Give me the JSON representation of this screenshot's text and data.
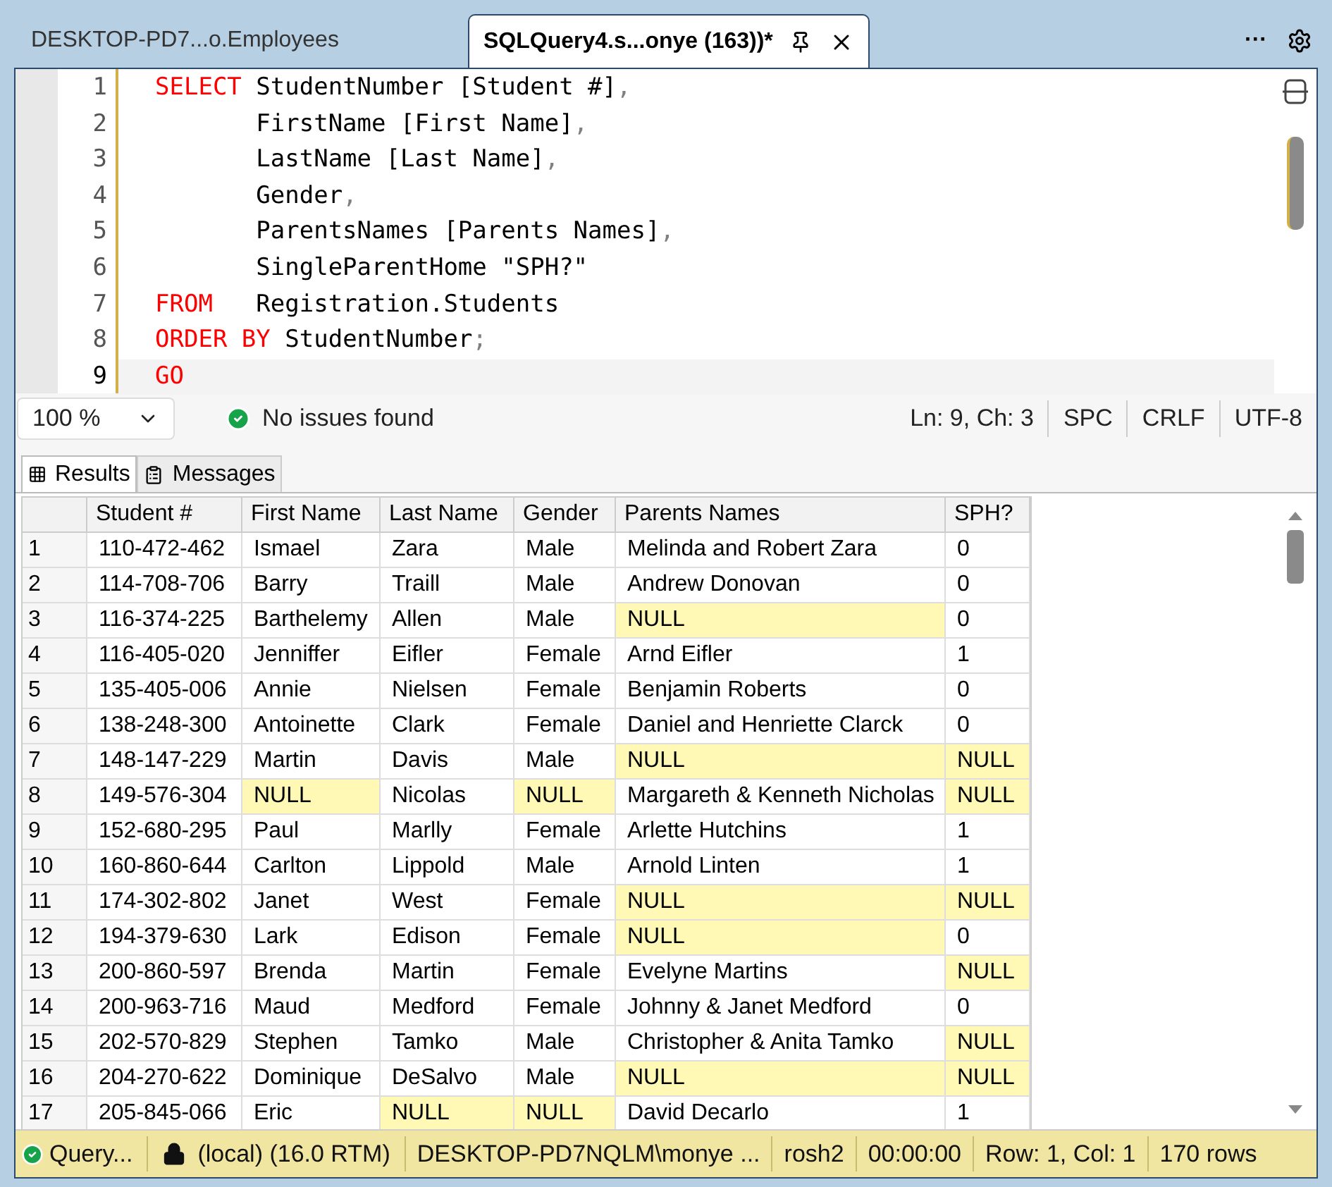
{
  "tabs": [
    {
      "label": "DESKTOP-PD7...o.Employees",
      "selected": false
    },
    {
      "label": "SQLQuery4.s...onye (163))*",
      "selected": true
    }
  ],
  "tab_bar_actions": {
    "more": "···"
  },
  "editor": {
    "lines": [
      {
        "number": "1",
        "current": false,
        "tokens": [
          {
            "kind": "keyword",
            "text": "SELECT"
          },
          {
            "kind": "text",
            "text": " StudentNumber [Student #]"
          },
          {
            "kind": "punct",
            "text": ","
          }
        ]
      },
      {
        "number": "2",
        "current": false,
        "tokens": [
          {
            "kind": "text",
            "text": "       FirstName [First Name]"
          },
          {
            "kind": "punct",
            "text": ","
          }
        ]
      },
      {
        "number": "3",
        "current": false,
        "tokens": [
          {
            "kind": "text",
            "text": "       LastName [Last Name]"
          },
          {
            "kind": "punct",
            "text": ","
          }
        ]
      },
      {
        "number": "4",
        "current": false,
        "tokens": [
          {
            "kind": "text",
            "text": "       Gender"
          },
          {
            "kind": "punct",
            "text": ","
          }
        ]
      },
      {
        "number": "5",
        "current": false,
        "tokens": [
          {
            "kind": "text",
            "text": "       ParentsNames [Parents Names]"
          },
          {
            "kind": "punct",
            "text": ","
          }
        ]
      },
      {
        "number": "6",
        "current": false,
        "tokens": [
          {
            "kind": "text",
            "text": "       SingleParentHome \"SPH?\""
          }
        ]
      },
      {
        "number": "7",
        "current": false,
        "tokens": [
          {
            "kind": "keyword",
            "text": "FROM"
          },
          {
            "kind": "text",
            "text": "   Registration.Students"
          }
        ]
      },
      {
        "number": "8",
        "current": false,
        "tokens": [
          {
            "kind": "keyword",
            "text": "ORDER BY"
          },
          {
            "kind": "text",
            "text": " StudentNumber"
          },
          {
            "kind": "punct",
            "text": ";"
          }
        ]
      },
      {
        "number": "9",
        "current": true,
        "tokens": [
          {
            "kind": "keyword",
            "text": "GO"
          }
        ]
      }
    ]
  },
  "editor_status": {
    "zoom": "100 %",
    "issues": "No issues found",
    "items": [
      "Ln: 9, Ch: 3",
      "SPC",
      "CRLF",
      "UTF-8"
    ]
  },
  "result_tabs": [
    {
      "label": "Results",
      "selected": true
    },
    {
      "label": "Messages",
      "selected": false
    }
  ],
  "grid": {
    "columns": [
      "Student #",
      "First Name",
      "Last Name",
      "Gender",
      "Parents Names",
      "SPH?"
    ],
    "rows": [
      {
        "number": "1",
        "cells": [
          {
            "text": "110-472-462",
            "null": false
          },
          {
            "text": "Ismael",
            "null": false
          },
          {
            "text": "Zara",
            "null": false
          },
          {
            "text": "Male",
            "null": false
          },
          {
            "text": "Melinda and Robert Zara",
            "null": false
          },
          {
            "text": "0",
            "null": false
          }
        ]
      },
      {
        "number": "2",
        "cells": [
          {
            "text": "114-708-706",
            "null": false
          },
          {
            "text": "Barry",
            "null": false
          },
          {
            "text": "Traill",
            "null": false
          },
          {
            "text": "Male",
            "null": false
          },
          {
            "text": "Andrew Donovan",
            "null": false
          },
          {
            "text": "0",
            "null": false
          }
        ]
      },
      {
        "number": "3",
        "cells": [
          {
            "text": "116-374-225",
            "null": false
          },
          {
            "text": "Barthelemy",
            "null": false
          },
          {
            "text": "Allen",
            "null": false
          },
          {
            "text": "Male",
            "null": false
          },
          {
            "text": "NULL",
            "null": true
          },
          {
            "text": "0",
            "null": false
          }
        ]
      },
      {
        "number": "4",
        "cells": [
          {
            "text": "116-405-020",
            "null": false
          },
          {
            "text": "Jenniffer",
            "null": false
          },
          {
            "text": "Eifler",
            "null": false
          },
          {
            "text": "Female",
            "null": false
          },
          {
            "text": "Arnd Eifler",
            "null": false
          },
          {
            "text": "1",
            "null": false
          }
        ]
      },
      {
        "number": "5",
        "cells": [
          {
            "text": "135-405-006",
            "null": false
          },
          {
            "text": "Annie",
            "null": false
          },
          {
            "text": "Nielsen",
            "null": false
          },
          {
            "text": "Female",
            "null": false
          },
          {
            "text": "Benjamin Roberts",
            "null": false
          },
          {
            "text": "0",
            "null": false
          }
        ]
      },
      {
        "number": "6",
        "cells": [
          {
            "text": "138-248-300",
            "null": false
          },
          {
            "text": "Antoinette",
            "null": false
          },
          {
            "text": "Clark",
            "null": false
          },
          {
            "text": "Female",
            "null": false
          },
          {
            "text": "Daniel and Henriette Clarck",
            "null": false
          },
          {
            "text": "0",
            "null": false
          }
        ]
      },
      {
        "number": "7",
        "cells": [
          {
            "text": "148-147-229",
            "null": false
          },
          {
            "text": "Martin",
            "null": false
          },
          {
            "text": "Davis",
            "null": false
          },
          {
            "text": "Male",
            "null": false
          },
          {
            "text": "NULL",
            "null": true
          },
          {
            "text": "NULL",
            "null": true
          }
        ]
      },
      {
        "number": "8",
        "cells": [
          {
            "text": "149-576-304",
            "null": false
          },
          {
            "text": "NULL",
            "null": true
          },
          {
            "text": "Nicolas",
            "null": false
          },
          {
            "text": "NULL",
            "null": true
          },
          {
            "text": "Margareth & Kenneth Nicholas",
            "null": false
          },
          {
            "text": "NULL",
            "null": true
          }
        ]
      },
      {
        "number": "9",
        "cells": [
          {
            "text": "152-680-295",
            "null": false
          },
          {
            "text": "Paul",
            "null": false
          },
          {
            "text": "Marlly",
            "null": false
          },
          {
            "text": "Female",
            "null": false
          },
          {
            "text": "Arlette Hutchins",
            "null": false
          },
          {
            "text": "1",
            "null": false
          }
        ]
      },
      {
        "number": "10",
        "cells": [
          {
            "text": "160-860-644",
            "null": false
          },
          {
            "text": "Carlton",
            "null": false
          },
          {
            "text": "Lippold",
            "null": false
          },
          {
            "text": "Male",
            "null": false
          },
          {
            "text": "Arnold Linten",
            "null": false
          },
          {
            "text": "1",
            "null": false
          }
        ]
      },
      {
        "number": "11",
        "cells": [
          {
            "text": "174-302-802",
            "null": false
          },
          {
            "text": "Janet",
            "null": false
          },
          {
            "text": "West",
            "null": false
          },
          {
            "text": "Female",
            "null": false
          },
          {
            "text": "NULL",
            "null": true
          },
          {
            "text": "NULL",
            "null": true
          }
        ]
      },
      {
        "number": "12",
        "cells": [
          {
            "text": "194-379-630",
            "null": false
          },
          {
            "text": "Lark",
            "null": false
          },
          {
            "text": "Edison",
            "null": false
          },
          {
            "text": "Female",
            "null": false
          },
          {
            "text": "NULL",
            "null": true
          },
          {
            "text": "0",
            "null": false
          }
        ]
      },
      {
        "number": "13",
        "cells": [
          {
            "text": "200-860-597",
            "null": false
          },
          {
            "text": "Brenda",
            "null": false
          },
          {
            "text": "Martin",
            "null": false
          },
          {
            "text": "Female",
            "null": false
          },
          {
            "text": "Evelyne Martins",
            "null": false
          },
          {
            "text": "NULL",
            "null": true
          }
        ]
      },
      {
        "number": "14",
        "cells": [
          {
            "text": "200-963-716",
            "null": false
          },
          {
            "text": "Maud",
            "null": false
          },
          {
            "text": "Medford",
            "null": false
          },
          {
            "text": "Female",
            "null": false
          },
          {
            "text": "Johnny & Janet Medford",
            "null": false
          },
          {
            "text": "0",
            "null": false
          }
        ]
      },
      {
        "number": "15",
        "cells": [
          {
            "text": "202-570-829",
            "null": false
          },
          {
            "text": "Stephen",
            "null": false
          },
          {
            "text": "Tamko",
            "null": false
          },
          {
            "text": "Male",
            "null": false
          },
          {
            "text": "Christopher & Anita Tamko",
            "null": false
          },
          {
            "text": "NULL",
            "null": true
          }
        ]
      },
      {
        "number": "16",
        "cells": [
          {
            "text": "204-270-622",
            "null": false
          },
          {
            "text": "Dominique",
            "null": false
          },
          {
            "text": "DeSalvo",
            "null": false
          },
          {
            "text": "Male",
            "null": false
          },
          {
            "text": "NULL",
            "null": true
          },
          {
            "text": "NULL",
            "null": true
          }
        ]
      },
      {
        "number": "17",
        "cells": [
          {
            "text": "205-845-066",
            "null": false
          },
          {
            "text": "Eric",
            "null": false
          },
          {
            "text": "NULL",
            "null": true
          },
          {
            "text": "NULL",
            "null": true
          },
          {
            "text": "David Decarlo",
            "null": false
          },
          {
            "text": "1",
            "null": false
          }
        ]
      }
    ]
  },
  "status_bar": {
    "query_status": "Query...",
    "server": "(local) (16.0 RTM)",
    "user": "DESKTOP-PD7NQLM\\monye ...",
    "database": "rosh2",
    "elapsed": "00:00:00",
    "position": "Row: 1, Col: 1",
    "row_count": "170 rows"
  }
}
